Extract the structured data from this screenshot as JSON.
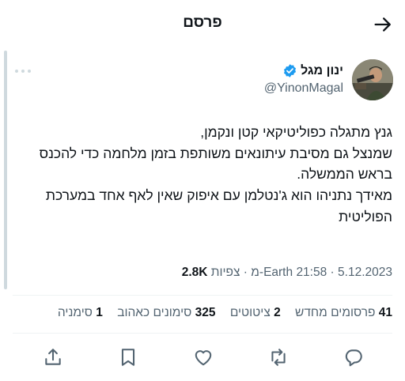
{
  "header": {
    "title": "פרסם",
    "back_icon": "arrow-right-icon"
  },
  "author": {
    "display_name": "ינון מגל",
    "handle": "@YinonMagal",
    "verified_icon": "verified-badge-icon",
    "verified_color": "#1d9bf0"
  },
  "tweet": {
    "lines": [
      "גנץ מתגלה כפוליטיקאי קטן ונקמן,",
      "שמנצל גם מסיבת עיתונאים משותפת בזמן מלחמה כדי להכנס",
      "בראש הממשלה.",
      "מאידך נתניהו הוא ג'נטלמן עם איפוק שאין לאף אחד במערכת",
      "הפוליטית"
    ]
  },
  "meta": {
    "date": "5.12.2023",
    "time": "21:58",
    "source": "Earth-מ",
    "separator": "·",
    "views_count": "2.8K",
    "views_label": "צפיות"
  },
  "stats": {
    "reposts_count": "41",
    "reposts_label": "פרסומים מחדש",
    "quotes_count": "2",
    "quotes_label": "ציטוטים",
    "likes_count": "325",
    "likes_label": "סימונים כאהוב",
    "bookmarks_count": "1",
    "bookmarks_label": "סימניה"
  },
  "actions": [
    "share-icon",
    "bookmark-icon",
    "heart-icon",
    "retweet-icon",
    "reply-icon"
  ],
  "more_icon": "more-dots-icon"
}
